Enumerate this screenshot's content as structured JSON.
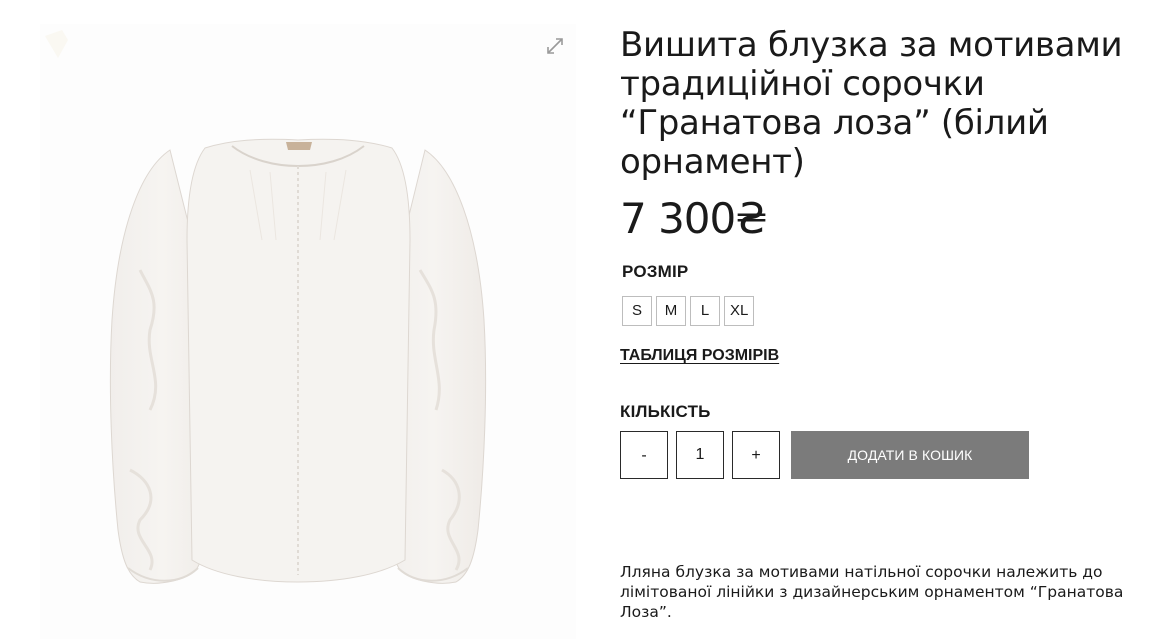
{
  "product": {
    "title": "Вишита блузка за мотивами традиційної сорочки “Гранатова лоза” (білий орнамент)",
    "price": "7 300₴",
    "size_label": "РОЗМІР",
    "sizes": [
      "S",
      "M",
      "L",
      "XL"
    ],
    "size_chart_link": "ТАБЛИЦЯ РОЗМІРІВ",
    "quantity_label": "КІЛЬКІСТЬ",
    "quantity_decrease": "-",
    "quantity_value": "1",
    "quantity_increase": "+",
    "add_to_cart": "ДОДАТИ В КОШИК",
    "description": "Лляна блузка за мотивами натільної сорочки належить до лімітованої лінійки з дизайнерським орнаментом “Гранатова Лоза”."
  },
  "gallery": {
    "zoom_icon": "expand-arrows-icon",
    "image": "white-embroidered-blouse"
  },
  "colors": {
    "add_to_cart_bg": "#7b7b7b",
    "text": "#1a1a1a"
  }
}
